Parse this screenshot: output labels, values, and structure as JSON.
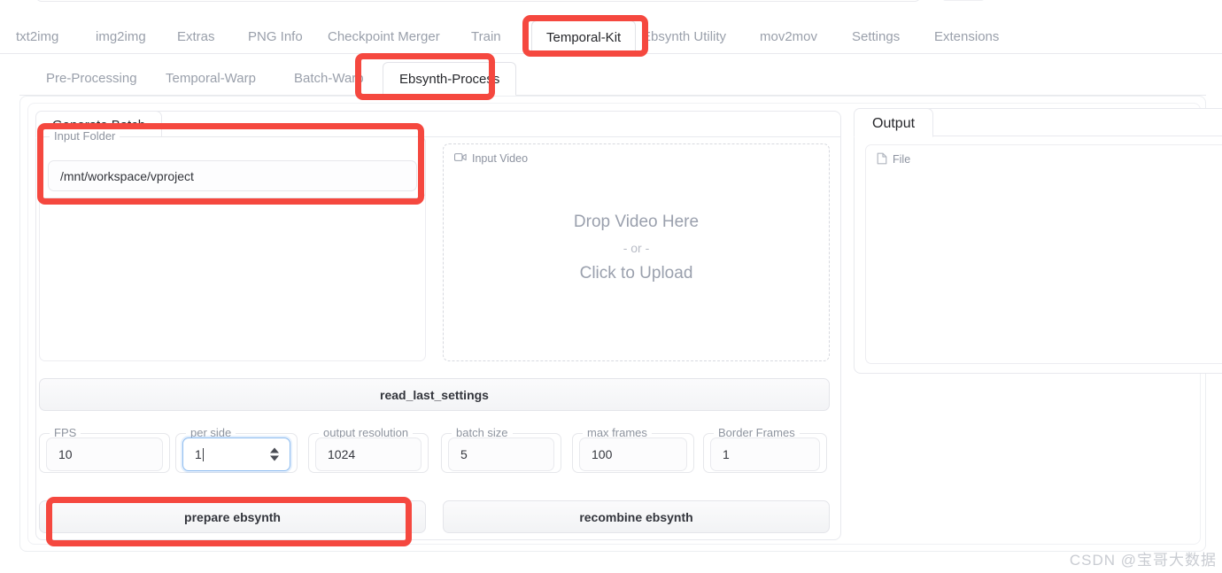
{
  "app": {
    "top_tabs": [
      {
        "label": "txt2img",
        "active": false
      },
      {
        "label": "img2img",
        "active": false
      },
      {
        "label": "Extras",
        "active": false
      },
      {
        "label": "PNG Info",
        "active": false
      },
      {
        "label": "Checkpoint Merger",
        "active": false
      },
      {
        "label": "Train",
        "active": false
      },
      {
        "label": "Temporal-Kit",
        "active": true
      },
      {
        "label": "Ebsynth Utility",
        "active": false
      },
      {
        "label": "mov2mov",
        "active": false
      },
      {
        "label": "Settings",
        "active": false
      },
      {
        "label": "Extensions",
        "active": false
      }
    ],
    "sub_tabs": [
      {
        "label": "Pre-Processing",
        "active": false
      },
      {
        "label": "Temporal-Warp",
        "active": false
      },
      {
        "label": "Batch-Warp",
        "active": false
      },
      {
        "label": "Ebsynth-Process",
        "active": true
      }
    ]
  },
  "left_panel": {
    "card_tab_label": "Generate Batch",
    "input_folder": {
      "legend": "Input Folder",
      "value": "/mnt/workspace/vproject",
      "placeholder": ""
    },
    "input_video": {
      "chip_label": "Input Video",
      "chip_icon": "video-camera-icon",
      "line1": "Drop Video Here",
      "separator": "- or -",
      "line2": "Click to Upload"
    },
    "read_last_settings_label": "read_last_settings",
    "params": [
      {
        "legend": "FPS",
        "value": "10",
        "focused": false,
        "spinner": false
      },
      {
        "legend": "per side",
        "value": "1",
        "focused": true,
        "spinner": true
      },
      {
        "legend": "output resolution",
        "value": "1024",
        "focused": false,
        "spinner": false
      },
      {
        "legend": "batch size",
        "value": "5",
        "focused": false,
        "spinner": false
      },
      {
        "legend": "max frames",
        "value": "100",
        "focused": false,
        "spinner": false
      },
      {
        "legend": "Border Frames",
        "value": "1",
        "focused": false,
        "spinner": false
      }
    ],
    "buttons": {
      "prepare_label": "prepare ebsynth",
      "recombine_label": "recombine ebsynth"
    }
  },
  "right_panel": {
    "card_tab_label": "Output",
    "file_chip_label": "File",
    "file_chip_icon": "file-icon"
  },
  "annotations": {
    "color": "#f5483f",
    "boxes": [
      {
        "name": "temporal-kit-tab",
        "target": "Temporal-Kit"
      },
      {
        "name": "ebsynth-process-tab",
        "target": "Ebsynth-Process"
      },
      {
        "name": "input-folder-field",
        "target": "Input Folder"
      },
      {
        "name": "prepare-ebsynth-button",
        "target": "prepare ebsynth"
      }
    ]
  },
  "watermark": {
    "text": "CSDN @宝哥大数据"
  }
}
